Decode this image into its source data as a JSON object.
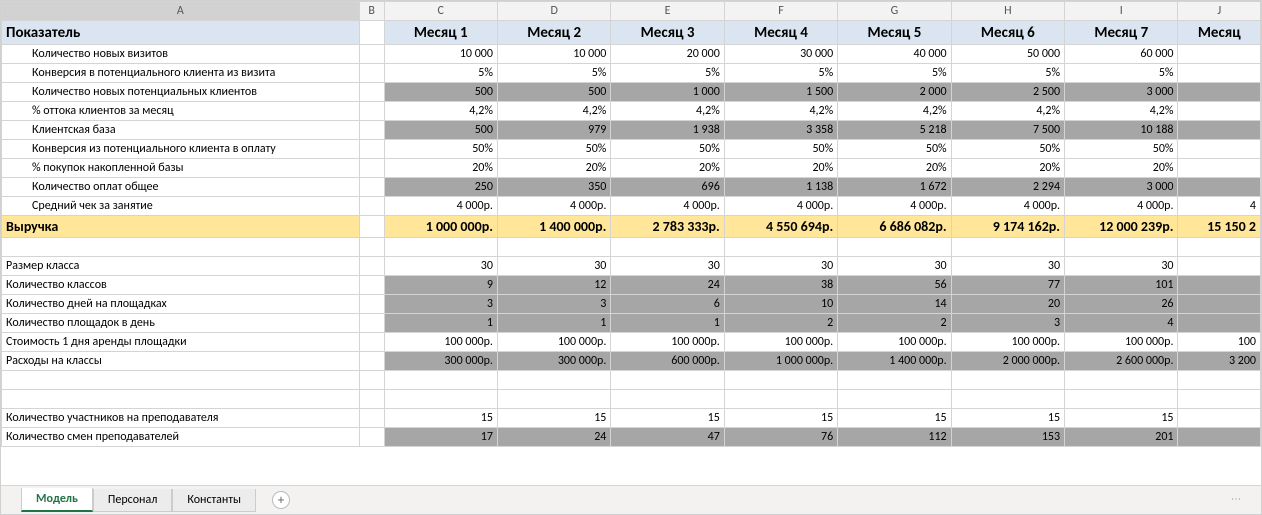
{
  "columns": [
    "A",
    "B",
    "C",
    "D",
    "E",
    "F",
    "G",
    "H",
    "I",
    "J"
  ],
  "header": {
    "label": "Показатель",
    "months": [
      "Месяц 1",
      "Месяц 2",
      "Месяц 3",
      "Месяц 4",
      "Месяц 5",
      "Месяц 6",
      "Месяц 7",
      "Месяц"
    ]
  },
  "rows": [
    {
      "label": "Количество новых визитов",
      "indent": true,
      "grey": false,
      "vals": [
        "10 000",
        "10 000",
        "20 000",
        "30 000",
        "40 000",
        "50 000",
        "60 000",
        ""
      ]
    },
    {
      "label": "Конверсия в потенциального клиента из визита",
      "indent": true,
      "grey": false,
      "vals": [
        "5%",
        "5%",
        "5%",
        "5%",
        "5%",
        "5%",
        "5%",
        ""
      ]
    },
    {
      "label": "Количество новых потенциальных клиентов",
      "indent": true,
      "grey": true,
      "vals": [
        "500",
        "500",
        "1 000",
        "1 500",
        "2 000",
        "2 500",
        "3 000",
        ""
      ]
    },
    {
      "label": "% оттока клиентов за месяц",
      "indent": true,
      "grey": false,
      "vals": [
        "4,2%",
        "4,2%",
        "4,2%",
        "4,2%",
        "4,2%",
        "4,2%",
        "4,2%",
        ""
      ]
    },
    {
      "label": "Клиентская база",
      "indent": true,
      "grey": true,
      "vals": [
        "500",
        "979",
        "1 938",
        "3 358",
        "5 218",
        "7 500",
        "10 188",
        ""
      ]
    },
    {
      "label": "Конверсия из потенциального клиента в оплату",
      "indent": true,
      "grey": false,
      "vals": [
        "50%",
        "50%",
        "50%",
        "50%",
        "50%",
        "50%",
        "50%",
        ""
      ]
    },
    {
      "label": "% покупок накопленной базы",
      "indent": true,
      "grey": false,
      "vals": [
        "20%",
        "20%",
        "20%",
        "20%",
        "20%",
        "20%",
        "20%",
        ""
      ]
    },
    {
      "label": "Количество оплат общее",
      "indent": true,
      "grey": true,
      "vals": [
        "250",
        "350",
        "696",
        "1 138",
        "1 672",
        "2 294",
        "3 000",
        ""
      ]
    },
    {
      "label": "Средний чек за занятие",
      "indent": true,
      "grey": false,
      "vals": [
        "4 000р.",
        "4 000р.",
        "4 000р.",
        "4 000р.",
        "4 000р.",
        "4 000р.",
        "4 000р.",
        "4"
      ]
    }
  ],
  "revenue": {
    "label": "Выручка",
    "vals": [
      "1 000 000р.",
      "1 400 000р.",
      "2 783 333р.",
      "4 550 694р.",
      "6 686 082р.",
      "9 174 162р.",
      "12 000 239р.",
      "15 150 2"
    ]
  },
  "rows2": [
    {
      "label": "",
      "indent": false,
      "grey": false,
      "vals": [
        "",
        "",
        "",
        "",
        "",
        "",
        "",
        ""
      ]
    },
    {
      "label": "Размер класса",
      "indent": false,
      "grey": false,
      "vals": [
        "30",
        "30",
        "30",
        "30",
        "30",
        "30",
        "30",
        ""
      ]
    },
    {
      "label": "Количество классов",
      "indent": false,
      "grey": true,
      "vals": [
        "9",
        "12",
        "24",
        "38",
        "56",
        "77",
        "101",
        ""
      ]
    },
    {
      "label": "Количество дней на площадках",
      "indent": false,
      "grey": true,
      "vals": [
        "3",
        "3",
        "6",
        "10",
        "14",
        "20",
        "26",
        ""
      ]
    },
    {
      "label": "Количество площадок в день",
      "indent": false,
      "grey": true,
      "vals": [
        "1",
        "1",
        "1",
        "2",
        "2",
        "3",
        "4",
        ""
      ]
    },
    {
      "label": "Стоимость 1 дня аренды площадки",
      "indent": false,
      "grey": false,
      "vals": [
        "100 000р.",
        "100 000р.",
        "100 000р.",
        "100 000р.",
        "100 000р.",
        "100 000р.",
        "100 000р.",
        "100"
      ]
    },
    {
      "label": "Расходы на классы",
      "indent": false,
      "grey": true,
      "vals": [
        "300 000р.",
        "300 000р.",
        "600 000р.",
        "1 000 000р.",
        "1 400 000р.",
        "2 000 000р.",
        "2 600 000р.",
        "3 200"
      ]
    },
    {
      "label": "",
      "indent": false,
      "grey": false,
      "vals": [
        "",
        "",
        "",
        "",
        "",
        "",
        "",
        ""
      ]
    },
    {
      "label": "",
      "indent": false,
      "grey": false,
      "vals": [
        "",
        "",
        "",
        "",
        "",
        "",
        "",
        ""
      ]
    },
    {
      "label": "Количество участников на преподавателя",
      "indent": false,
      "grey": false,
      "vals": [
        "15",
        "15",
        "15",
        "15",
        "15",
        "15",
        "15",
        ""
      ]
    },
    {
      "label": "Количество смен преподавателей",
      "indent": false,
      "grey": true,
      "vals": [
        "17",
        "24",
        "47",
        "76",
        "112",
        "153",
        "201",
        ""
      ]
    }
  ],
  "tabs": {
    "items": [
      "Модель",
      "Персонал",
      "Константы"
    ],
    "active": 0,
    "add": "+"
  }
}
